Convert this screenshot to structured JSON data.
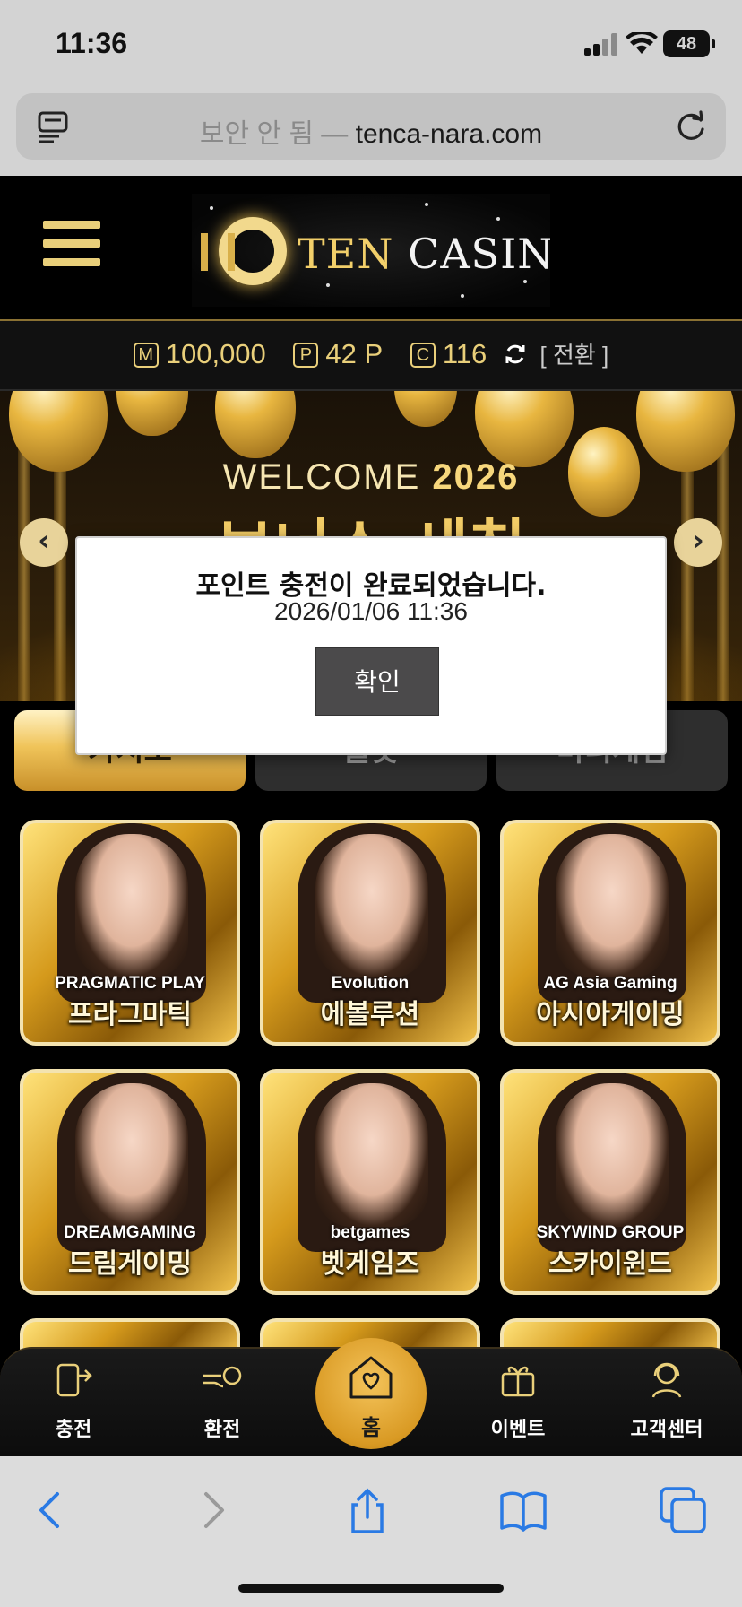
{
  "status": {
    "time": "11:36",
    "battery": "48"
  },
  "browser": {
    "insecure_label": "보안 안 됨 —",
    "domain": "tenca-nara.com"
  },
  "header": {
    "logo_ten": "TEN",
    "logo_casino": " CASINO"
  },
  "balance": {
    "money_icon": "M",
    "money": "100,000",
    "point_icon": "P",
    "points": "42 P",
    "coin_icon": "C",
    "coins": "116",
    "convert_label": "[ 전환 ]"
  },
  "banner": {
    "welcome": "WELCOME",
    "year": "2026",
    "big_text": "보너스 세칙"
  },
  "tabs": [
    {
      "label": "카지노",
      "active": true
    },
    {
      "label": "슬롯",
      "active": false
    },
    {
      "label": "미니게임",
      "active": false
    }
  ],
  "games": [
    {
      "provider": "PRAGMATIC PLAY",
      "name": "프라그마틱"
    },
    {
      "provider": "Evolution",
      "name": "에볼루션"
    },
    {
      "provider": "AG Asia Gaming",
      "name": "아시아게이밍"
    },
    {
      "provider": "DREAMGAMING",
      "name": "드림게이밍"
    },
    {
      "provider": "betgames",
      "name": "벳게임즈"
    },
    {
      "provider": "SKYWIND GROUP",
      "name": "스카이윈드"
    }
  ],
  "bottom_nav": {
    "charge": "충전",
    "exchange": "환전",
    "home": "홈",
    "event": "이벤트",
    "support": "고객센터"
  },
  "modal": {
    "message": "포인트 충전이 완료되었습니다.",
    "date": "2026/01/06 11:36",
    "ok_label": "확인"
  },
  "colors": {
    "gold": "#e9cf7a",
    "accent": "#d99a24",
    "modal_button": "#4b4a4b"
  }
}
